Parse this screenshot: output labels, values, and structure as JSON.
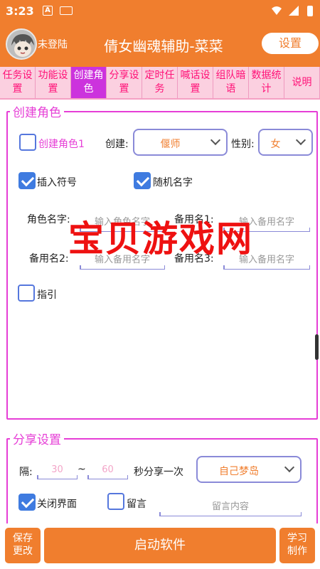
{
  "status_bar": {
    "time": "3:23",
    "icons": [
      "app-a-icon",
      "keyboard-icon",
      "wifi-icon",
      "signal-icon",
      "battery-icon"
    ]
  },
  "header": {
    "login_status": "未登陆",
    "title": "倩女幽魂辅助-菜菜",
    "settings_label": "设置"
  },
  "tabs": [
    {
      "label": "任务设置",
      "active": false
    },
    {
      "label": "功能设置",
      "active": false
    },
    {
      "label": "创建角色",
      "active": true
    },
    {
      "label": "分享设置",
      "active": false
    },
    {
      "label": "定时任务",
      "active": false
    },
    {
      "label": "喊话设置",
      "active": false
    },
    {
      "label": "组队暗语",
      "active": false
    },
    {
      "label": "数据统计",
      "active": false
    },
    {
      "label": "说明",
      "active": false
    }
  ],
  "create_role": {
    "title": "创建角色",
    "role1_label": "创建角色1",
    "role1_checked": false,
    "create_label": "创建:",
    "class_value": "偃师",
    "gender_label": "性别:",
    "gender_value": "女",
    "insert_symbol_label": "插入符号",
    "insert_symbol_checked": true,
    "random_name_label": "随机名字",
    "random_name_checked": true,
    "role_name_label": "角色名字:",
    "role_name_placeholder": "输入角色名字",
    "backup1_label": "备用名1:",
    "backup1_placeholder": "输入备用名字",
    "backup2_label": "备用名2:",
    "backup2_placeholder": "输入备用名字",
    "backup3_label": "备用名3:",
    "backup3_placeholder": "输入备用名字",
    "guide_label": "指引",
    "guide_checked": false
  },
  "share": {
    "title": "分享设置",
    "interval_label": "隔:",
    "interval_min": "30",
    "interval_sep": "~",
    "interval_max": "60",
    "interval_unit": "秒分享一次",
    "target_value": "自己梦岛",
    "close_ui_label": "关闭界面",
    "close_ui_checked": true,
    "comment_label": "留言",
    "comment_checked": false,
    "comment_placeholder": "留言内容"
  },
  "watermark": "宝贝游戏网",
  "bottom": {
    "save_label": "保存更改",
    "start_label": "启动软件",
    "learn_label": "学习制作"
  },
  "colors": {
    "accent": "#f07e2e",
    "tab_bg": "#fbd0e0",
    "tab_active": "#cc33dd",
    "group_border": "#e63ed6",
    "checkbox": "#3f7be0",
    "watermark": "#ee1111"
  }
}
